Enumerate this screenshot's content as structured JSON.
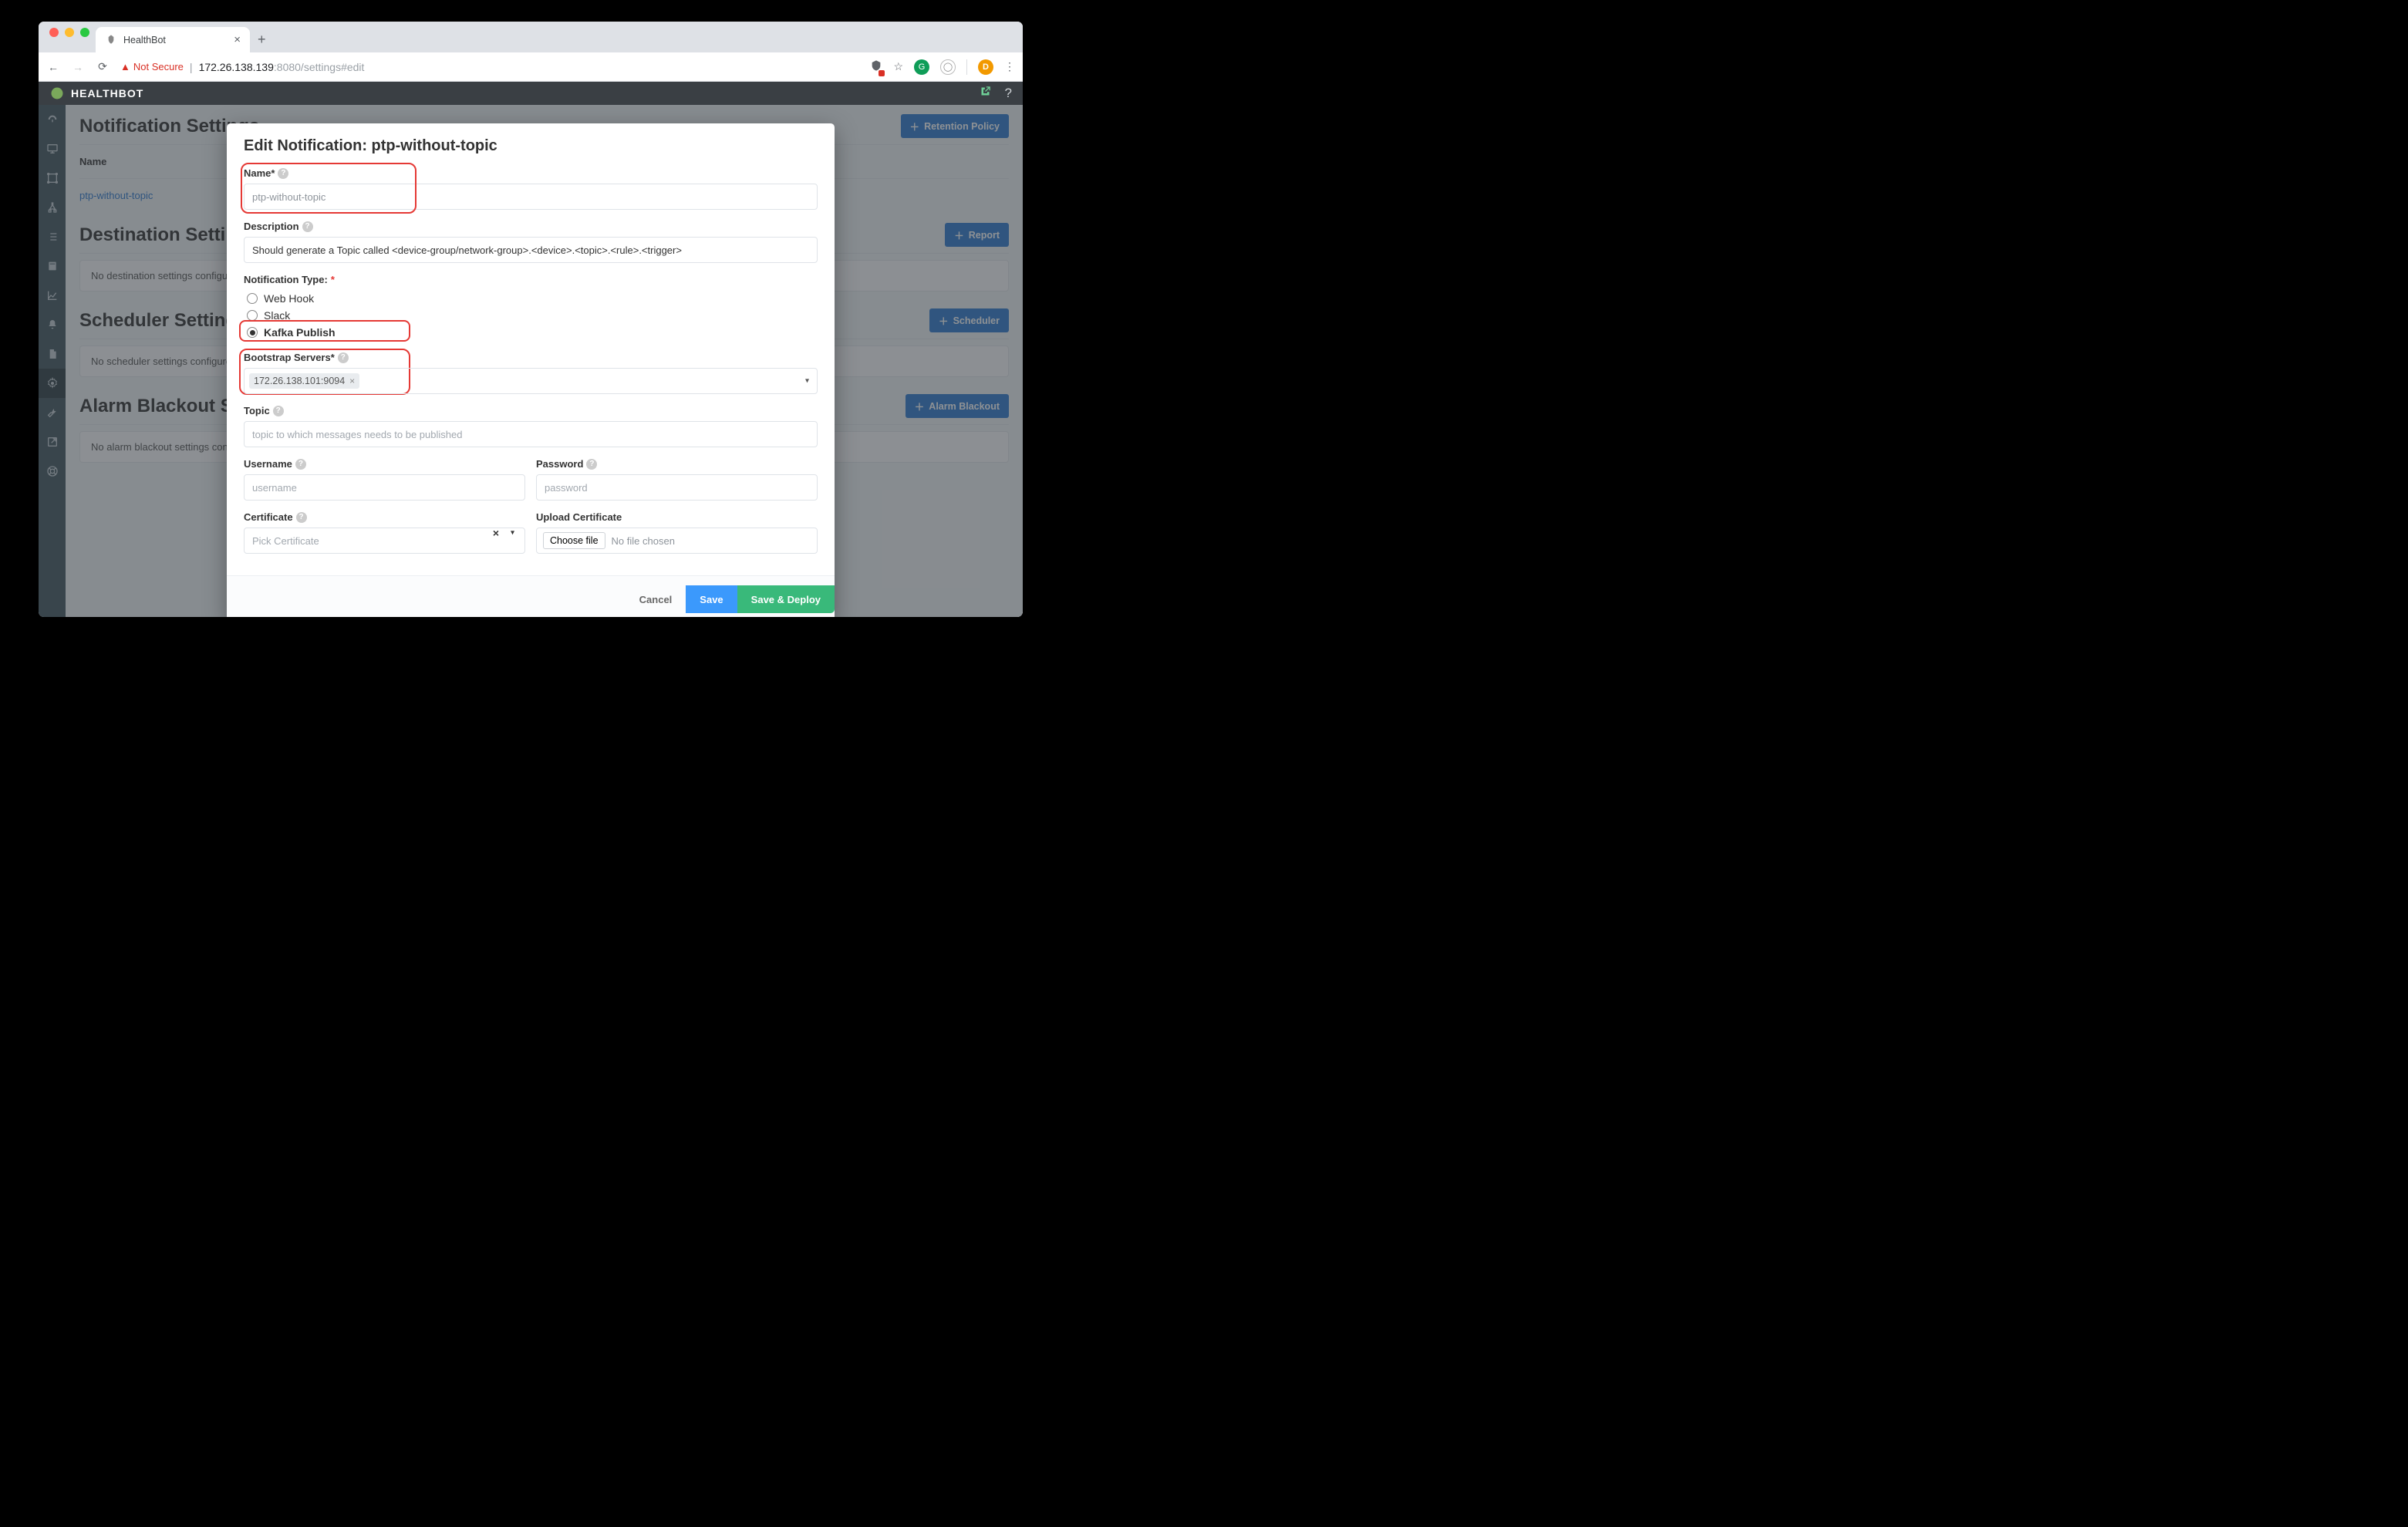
{
  "browser": {
    "tab_title": "HealthBot",
    "not_secure": "Not Secure",
    "url_host": "172.26.138.139",
    "url_port_path": ":8080/settings#edit",
    "avatar_letter": "D"
  },
  "topbar": {
    "brand": "HEALTHBOT"
  },
  "page": {
    "sec_notification": "Notification Settings",
    "btn_retention": "Retention Policy",
    "col_name": "Name",
    "row_name": "ptp-without-topic",
    "sec_destination": "Destination Settings",
    "btn_report": "Report",
    "dest_empty": "No destination settings configured.",
    "sec_scheduler": "Scheduler Settings",
    "btn_scheduler": "Scheduler",
    "sched_empty": "No scheduler settings configured.",
    "sec_blackout": "Alarm Blackout Settings",
    "btn_blackout": "Alarm Blackout",
    "blackout_empty": "No alarm blackout settings configured."
  },
  "modal": {
    "title": "Edit Notification: ptp-without-topic",
    "name_label": "Name*",
    "name_value": "ptp-without-topic",
    "desc_label": "Description",
    "desc_value": "Should generate a Topic called <device-group/network-group>.<device>.<topic>.<rule>.<trigger>",
    "type_label": "Notification Type:",
    "type_options": {
      "webhook": "Web Hook",
      "slack": "Slack",
      "kafka": "Kafka Publish"
    },
    "bootstrap_label": "Bootstrap Servers*",
    "bootstrap_tag": "172.26.138.101:9094",
    "topic_label": "Topic",
    "topic_placeholder": "topic to which messages needs to be published",
    "username_label": "Username",
    "username_placeholder": "username",
    "password_label": "Password",
    "password_placeholder": "password",
    "cert_label": "Certificate",
    "cert_placeholder": "Pick Certificate",
    "upload_label": "Upload Certificate",
    "choose_file": "Choose file",
    "no_file": "No file chosen",
    "btn_cancel": "Cancel",
    "btn_save": "Save",
    "btn_deploy": "Save & Deploy"
  }
}
